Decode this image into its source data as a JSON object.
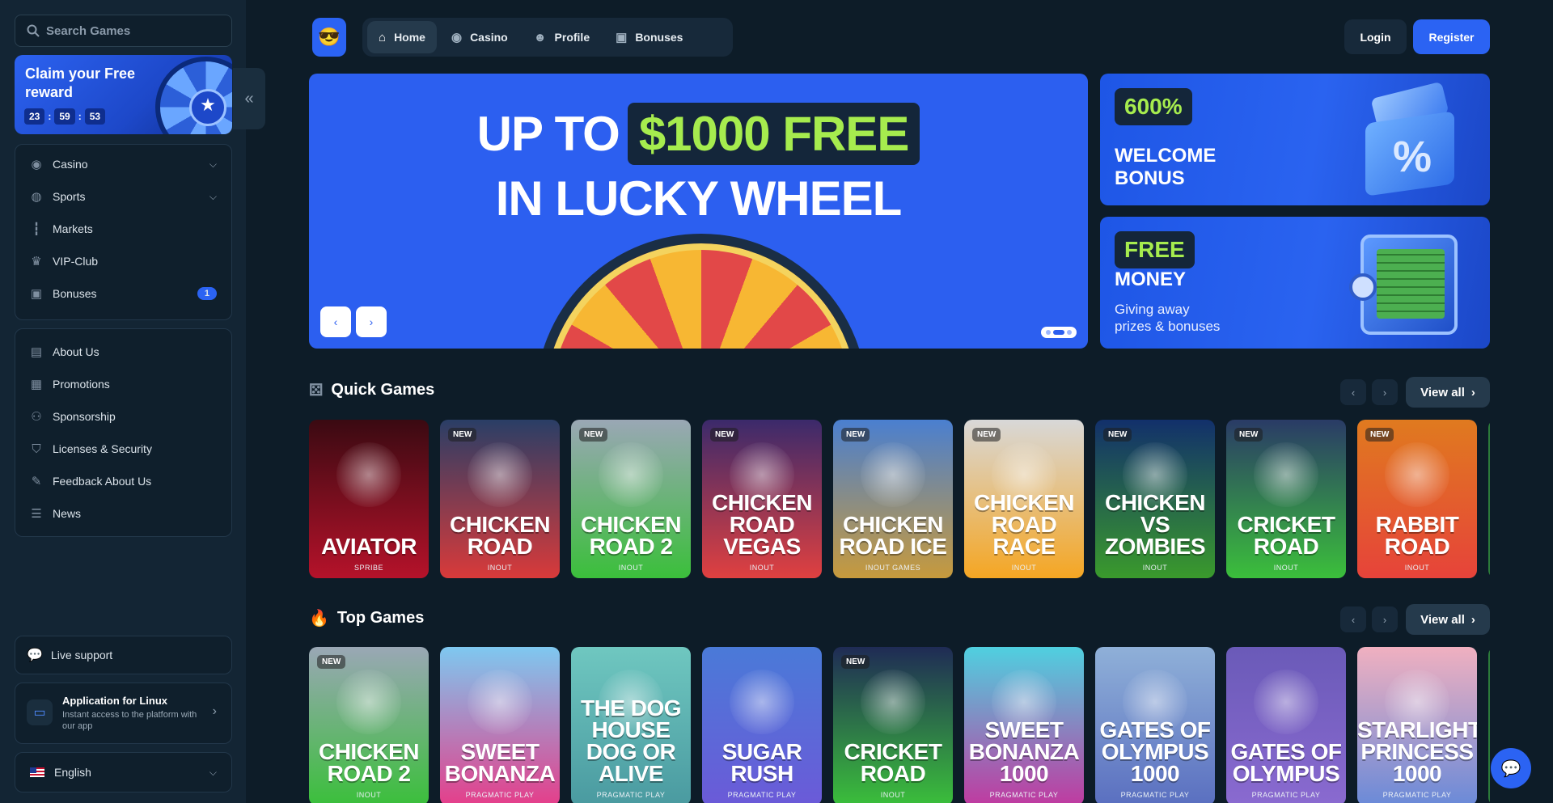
{
  "search": {
    "placeholder": "Search Games"
  },
  "reward": {
    "title": "Claim your Free reward",
    "timer": [
      "23",
      "59",
      "53"
    ],
    "separator": ":"
  },
  "sidebar": {
    "primary": [
      {
        "label": "Casino",
        "icon": "casino-chip-icon",
        "dropdown": true
      },
      {
        "label": "Sports",
        "icon": "globe-icon",
        "dropdown": true
      },
      {
        "label": "Markets",
        "icon": "candles-icon"
      },
      {
        "label": "VIP-Club",
        "icon": "crown-icon"
      },
      {
        "label": "Bonuses",
        "icon": "gift-icon",
        "badge": "1"
      }
    ],
    "secondary": [
      {
        "label": "About Us",
        "icon": "book-icon"
      },
      {
        "label": "Promotions",
        "icon": "megaphone-icon"
      },
      {
        "label": "Sponsorship",
        "icon": "handshake-icon"
      },
      {
        "label": "Licenses & Security",
        "icon": "shield-icon"
      },
      {
        "label": "Feedback About Us",
        "icon": "feedback-icon"
      },
      {
        "label": "News",
        "icon": "newspaper-icon"
      }
    ],
    "support": {
      "label": "Live support"
    },
    "app": {
      "title": "Application for Linux",
      "subtitle": "Instant access to the platform with our app"
    },
    "language": {
      "label": "English"
    }
  },
  "header": {
    "nav": [
      {
        "label": "Home",
        "icon": "home-icon",
        "active": true
      },
      {
        "label": "Casino",
        "icon": "casino-chip-icon"
      },
      {
        "label": "Profile",
        "icon": "user-icon"
      },
      {
        "label": "Bonuses",
        "icon": "gift-icon"
      }
    ],
    "login": "Login",
    "register": "Register"
  },
  "hero": {
    "line1_prefix": "UP TO",
    "line1_highlight": "$1000 FREE",
    "line2": "IN LUCKY WHEEL"
  },
  "banners": {
    "welcome": {
      "pill": "600%",
      "title_1": "WELCOME",
      "title_2": "BONUS"
    },
    "money": {
      "pill": "FREE",
      "title": "MONEY",
      "subtitle_1": "Giving away",
      "subtitle_2": "prizes & bonuses"
    }
  },
  "sections": {
    "quick": {
      "title": "Quick Games",
      "view_all": "View all",
      "games": [
        {
          "name": "AVIATOR",
          "provider": "SPRIBE",
          "new": false,
          "bg": [
            "#3a0a12",
            "#b5122a"
          ]
        },
        {
          "name": "CHICKEN ROAD",
          "provider": "INOUT",
          "new": true,
          "bg": [
            "#2a3e66",
            "#d93a3a"
          ]
        },
        {
          "name": "CHICKEN ROAD 2",
          "provider": "INOUT",
          "new": true,
          "bg": [
            "#9aa7b5",
            "#3bbf3b"
          ]
        },
        {
          "name": "CHICKEN ROAD VEGAS",
          "provider": "INOUT",
          "new": true,
          "bg": [
            "#3b2a6b",
            "#e04040"
          ]
        },
        {
          "name": "CHICKEN ROAD ICE",
          "provider": "INOUT GAMES",
          "new": true,
          "bg": [
            "#4a7fd0",
            "#c79a3c"
          ]
        },
        {
          "name": "CHICKEN ROAD RACE",
          "provider": "INOUT",
          "new": true,
          "bg": [
            "#d8d8d8",
            "#f5a623"
          ]
        },
        {
          "name": "CHICKEN VS ZOMBIES",
          "provider": "INOUT",
          "new": true,
          "bg": [
            "#12306b",
            "#3a9a2c"
          ]
        },
        {
          "name": "CRICKET ROAD",
          "provider": "INOUT",
          "new": true,
          "bg": [
            "#2a3b66",
            "#3bbf3b"
          ]
        },
        {
          "name": "RABBIT ROAD",
          "provider": "INOUT",
          "new": true,
          "bg": [
            "#e07a1f",
            "#e6433a"
          ]
        }
      ]
    },
    "top": {
      "title": "Top Games",
      "view_all": "View all",
      "games": [
        {
          "name": "CHICKEN ROAD 2",
          "provider": "INOUT",
          "new": true,
          "bg": [
            "#9aa7b5",
            "#3bbf3b"
          ]
        },
        {
          "name": "SWEET BONANZA",
          "provider": "PRAGMATIC PLAY",
          "new": false,
          "bg": [
            "#7ec8f0",
            "#e53e8a"
          ]
        },
        {
          "name": "THE DOG HOUSE DOG OR ALIVE",
          "provider": "PRAGMATIC PLAY",
          "new": false,
          "bg": [
            "#6fc7c0",
            "#4a9aa0"
          ]
        },
        {
          "name": "SUGAR RUSH",
          "provider": "PRAGMATIC PLAY",
          "new": false,
          "bg": [
            "#4a7ad8",
            "#6b5ad8"
          ]
        },
        {
          "name": "CRICKET ROAD",
          "provider": "INOUT",
          "new": true,
          "bg": [
            "#1f2b55",
            "#3bbf3b"
          ]
        },
        {
          "name": "SWEET BONANZA 1000",
          "provider": "PRAGMATIC PLAY",
          "new": false,
          "bg": [
            "#4fd0e0",
            "#c03aa0"
          ]
        },
        {
          "name": "GATES OF OLYMPUS 1000",
          "provider": "PRAGMATIC PLAY",
          "new": false,
          "bg": [
            "#8fb0d8",
            "#5a6fc0"
          ]
        },
        {
          "name": "GATES OF OLYMPUS",
          "provider": "PRAGMATIC PLAY",
          "new": false,
          "bg": [
            "#6a5ab8",
            "#8a6ad0"
          ]
        },
        {
          "name": "STARLIGHT PRINCESS 1000",
          "provider": "PRAGMATIC PLAY",
          "new": false,
          "bg": [
            "#f0b0c0",
            "#6a8ad8"
          ]
        }
      ]
    }
  },
  "colors": {
    "accent": "#2b63f3",
    "highlight": "#a6ec4e",
    "background": "#0d1c28",
    "sidebar": "#132534"
  }
}
